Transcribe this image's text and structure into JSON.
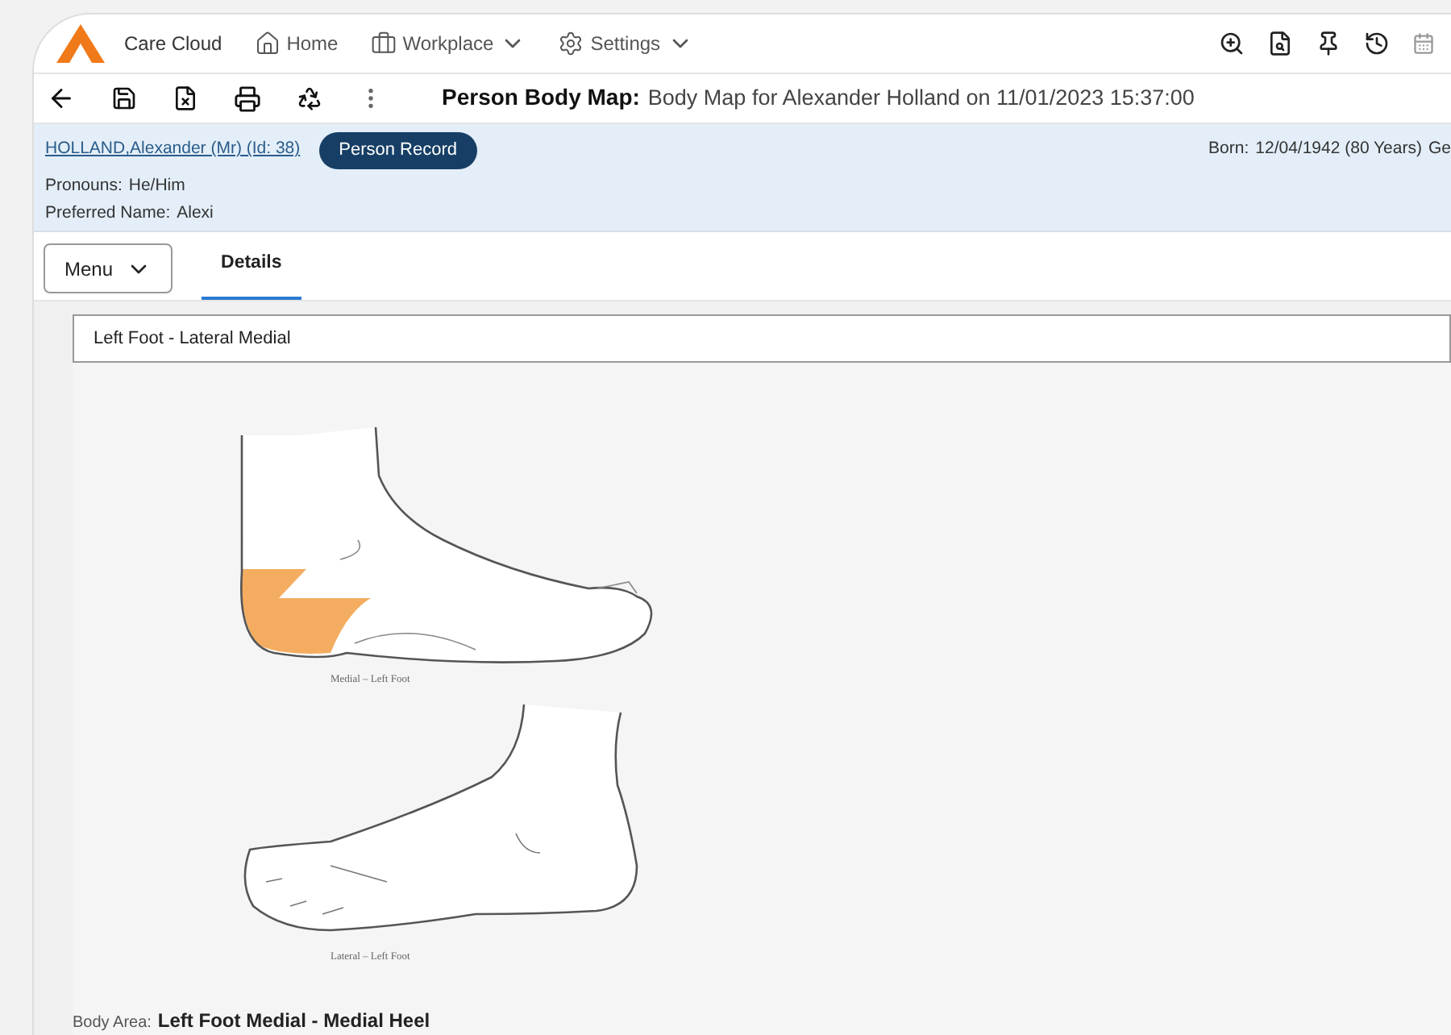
{
  "app": {
    "name": "Care Cloud"
  },
  "nav": [
    {
      "label": "Home",
      "kind": "home",
      "dropdown": false
    },
    {
      "label": "Workplace",
      "kind": "briefcase",
      "dropdown": true
    },
    {
      "label": "Settings",
      "kind": "gear",
      "dropdown": true
    }
  ],
  "page_title": {
    "label": "Person Body Map:",
    "value": "Body Map for Alexander Holland on 11/01/2023 15:37:00"
  },
  "patient": {
    "name_link": "HOLLAND,Alexander (Mr) (Id: 38)",
    "record_button": "Person Record",
    "born_label": "Born:",
    "born_value": "12/04/1942 (80 Years)",
    "cut_label": "Ge",
    "pronouns_label": "Pronouns:",
    "pronouns_value": "He/Him",
    "preferred_label": "Preferred Name:",
    "preferred_value": "Alexi"
  },
  "menu_button": "Menu",
  "tabs": [
    {
      "label": "Details",
      "selected": true
    }
  ],
  "body_map": {
    "select_value": "Left Foot - Lateral Medial",
    "views": [
      {
        "caption": "Medial – Left Foot",
        "kind": "medial",
        "highlighted": true
      },
      {
        "caption": "Lateral – Left Foot",
        "kind": "lateral",
        "highlighted": false
      }
    ],
    "body_area_label": "Body Area:",
    "body_area_value": "Left Foot Medial - Medial Heel"
  }
}
